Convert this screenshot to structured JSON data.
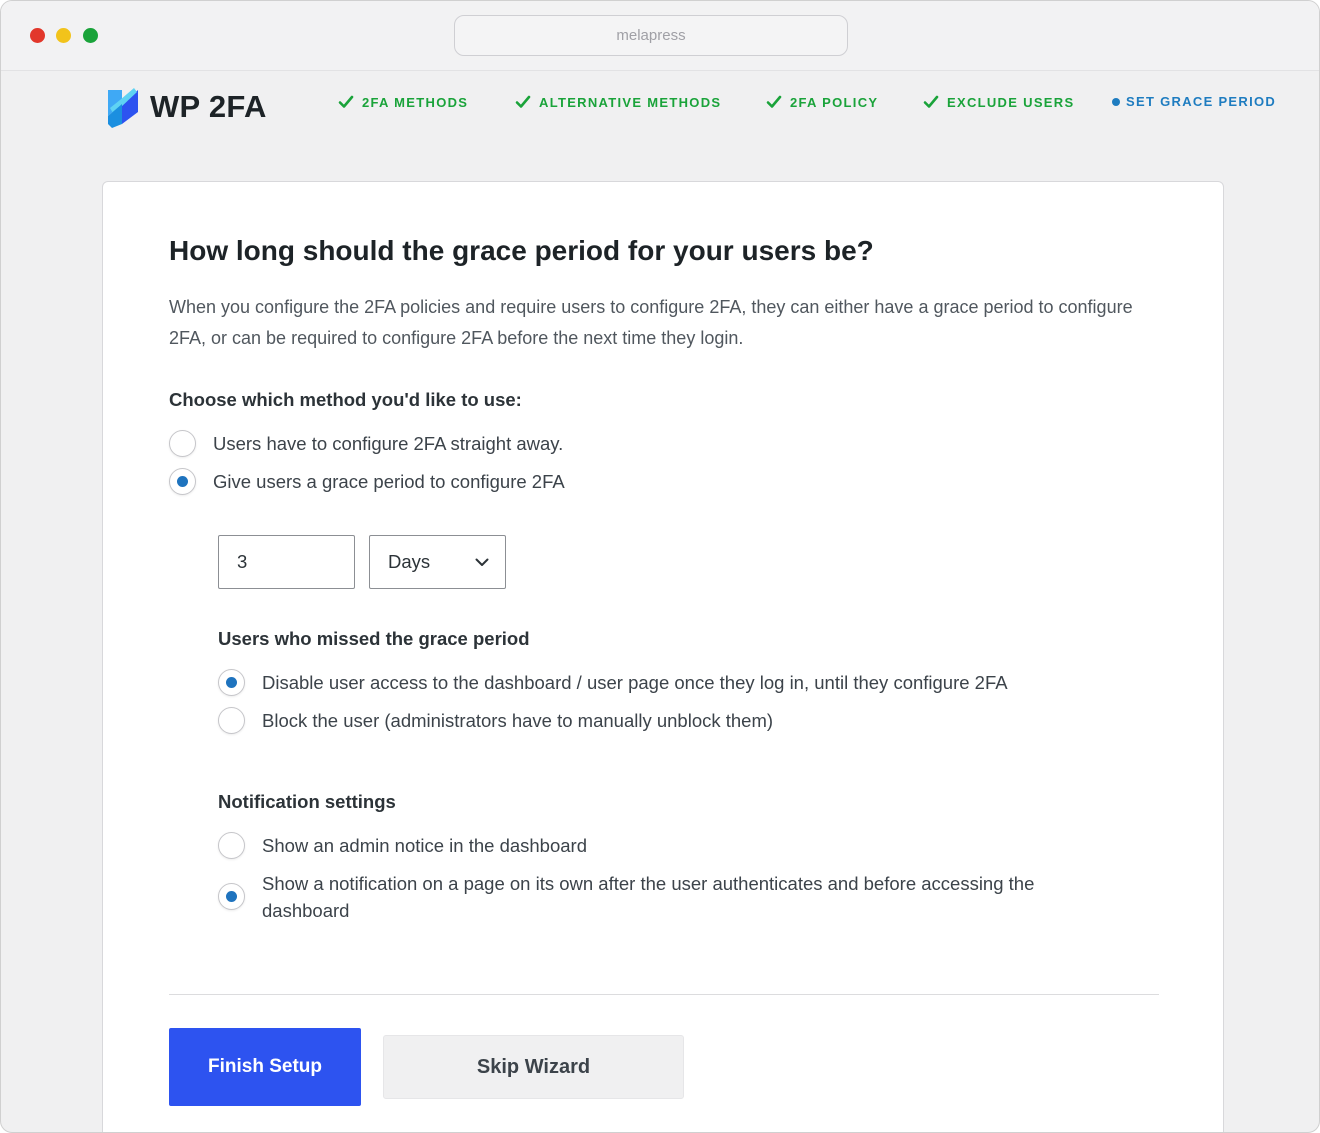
{
  "browser": {
    "url_text": "melapress"
  },
  "brand": {
    "name": "WP 2FA"
  },
  "steps": [
    {
      "label": "2FA METHODS",
      "state": "done"
    },
    {
      "label": "ALTERNATIVE METHODS",
      "state": "done"
    },
    {
      "label": "2FA POLICY",
      "state": "done"
    },
    {
      "label": "EXCLUDE USERS",
      "state": "done"
    },
    {
      "label": "SET GRACE PERIOD",
      "state": "active"
    }
  ],
  "main": {
    "title": "How long should the grace period for your users be?",
    "intro": "When you configure the 2FA policies and require users to configure 2FA, they can either have a grace period to configure 2FA, or can be required to configure 2FA before the next time they login.",
    "method_label": "Choose which method you'd like to use:",
    "method_options": [
      {
        "label": "Users have to configure 2FA straight away.",
        "checked": false
      },
      {
        "label": "Give users a grace period to configure 2FA",
        "checked": true
      }
    ],
    "grace_value": "3",
    "grace_unit": "Days",
    "missed_label": "Users who missed the grace period",
    "missed_options": [
      {
        "label": "Disable user access to the dashboard / user page once they log in, until they configure 2FA",
        "checked": true
      },
      {
        "label": "Block the user (administrators have to manually unblock them)",
        "checked": false
      }
    ],
    "notification_label": "Notification settings",
    "notification_options": [
      {
        "label": "Show an admin notice in the dashboard",
        "checked": false
      },
      {
        "label": "Show a notification on a page on its own after the user authenticates and before accessing the dashboard",
        "checked": true
      }
    ],
    "finish_label": "Finish Setup",
    "skip_label": "Skip Wizard"
  },
  "colors": {
    "done": "#1aa33a",
    "active": "#1e7cc0",
    "primary_button": "#2d53f0",
    "radio_checked": "#1e73be"
  }
}
